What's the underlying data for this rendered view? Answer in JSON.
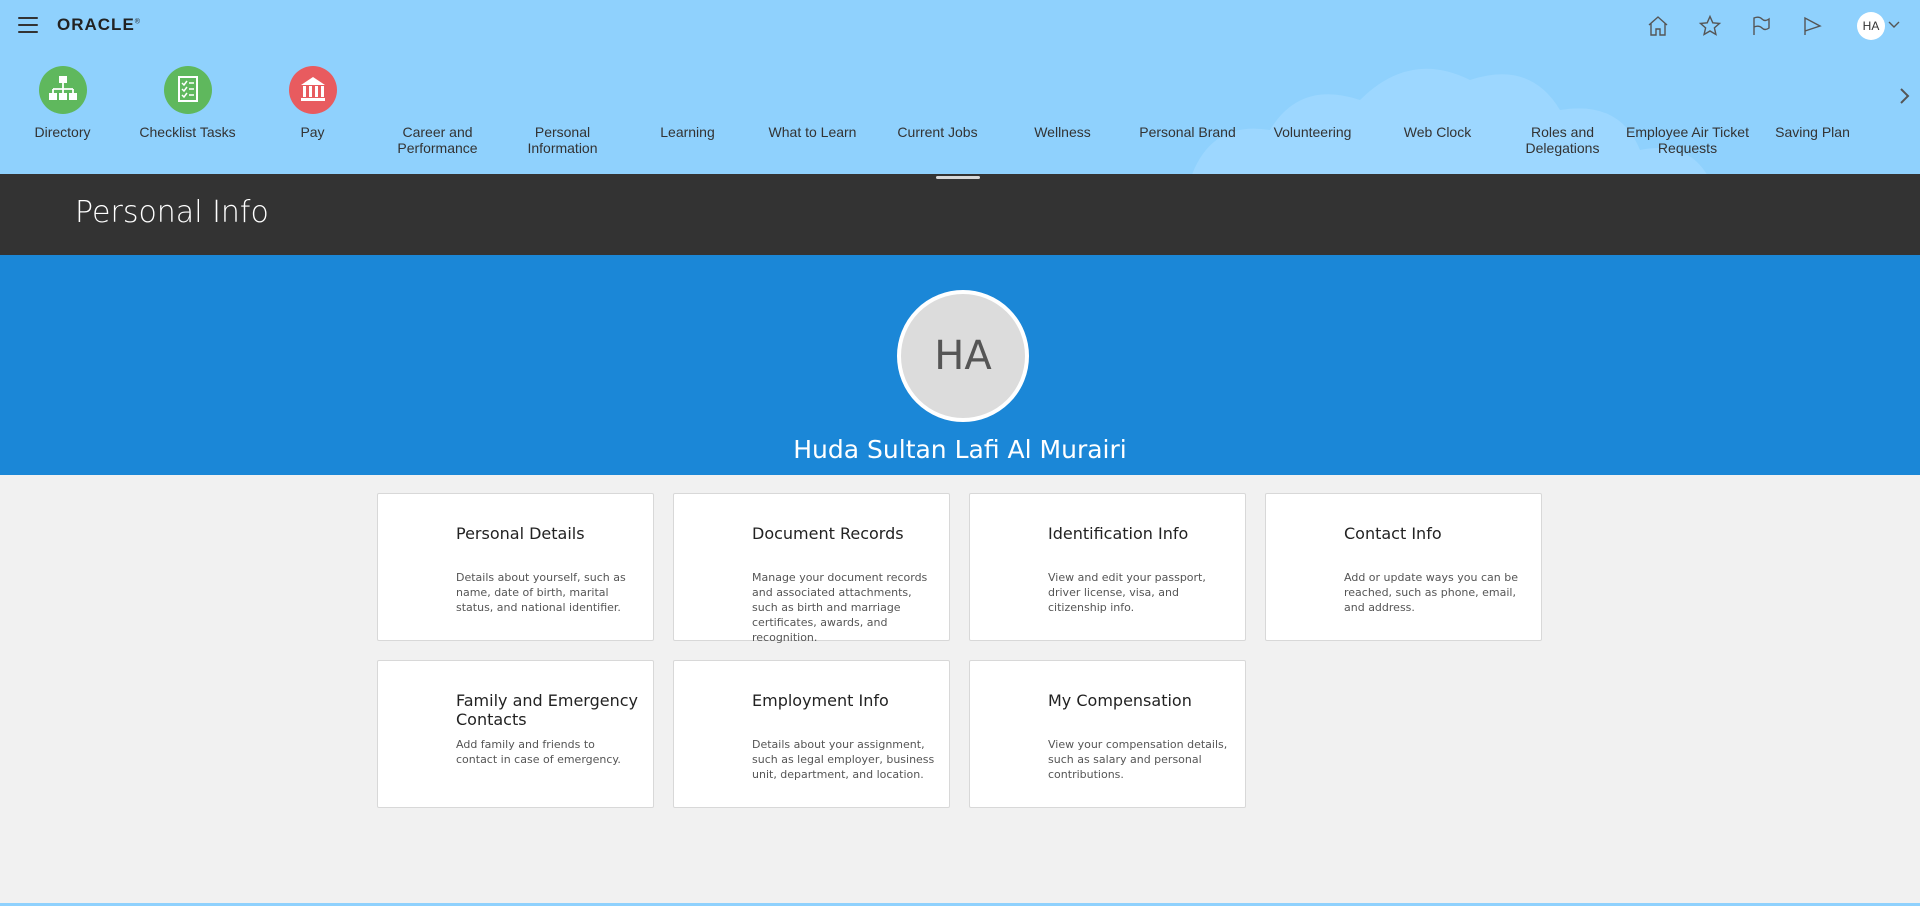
{
  "header": {
    "logo": "ORACLE",
    "logo_mark": "®",
    "user_initials": "HA"
  },
  "nav": {
    "items": [
      {
        "label": "Directory",
        "icon": "org-chart-icon",
        "color": "#5fb85d"
      },
      {
        "label": "Checklist Tasks",
        "icon": "checklist-icon",
        "color": "#5fb85d"
      },
      {
        "label": "Pay",
        "icon": "bank-icon",
        "color": "#e85b5f"
      },
      {
        "label": "Career and Performance"
      },
      {
        "label": "Personal Information"
      },
      {
        "label": "Learning"
      },
      {
        "label": "What to Learn"
      },
      {
        "label": "Current Jobs"
      },
      {
        "label": "Wellness"
      },
      {
        "label": "Personal Brand"
      },
      {
        "label": "Volunteering"
      },
      {
        "label": "Web Clock"
      },
      {
        "label": "Roles and Delegations"
      },
      {
        "label": "Employee Air Ticket Requests"
      },
      {
        "label": "Saving Plan"
      }
    ]
  },
  "page": {
    "title": "Personal Info"
  },
  "profile": {
    "initials": "HA",
    "name": "Huda Sultan Lafi Al Murairi"
  },
  "cards": [
    {
      "title": "Personal Details",
      "desc": "Details about yourself, such as name, date of birth, marital status, and national identifier."
    },
    {
      "title": "Document Records",
      "desc": "Manage your document records and associated attachments, such as birth and marriage certificates, awards, and recognition."
    },
    {
      "title": "Identification Info",
      "desc": "View and edit your passport, driver license, visa, and citizenship info."
    },
    {
      "title": "Contact Info",
      "desc": "Add or update ways you can be reached, such as phone, email, and address."
    },
    {
      "title": "Family and Emergency Contacts",
      "desc": "Add family and friends to contact in case of emergency."
    },
    {
      "title": "Employment Info",
      "desc": "Details about your assignment, such as legal employer, business unit, department, and location."
    },
    {
      "title": "My Compensation",
      "desc": "View your compensation details, such as salary and personal contributions."
    }
  ],
  "colors": {
    "header_bg": "#8fd1fd",
    "titlebar_bg": "#333333",
    "banner_bg": "#1b87d7",
    "page_bg": "#f1f1f1"
  }
}
